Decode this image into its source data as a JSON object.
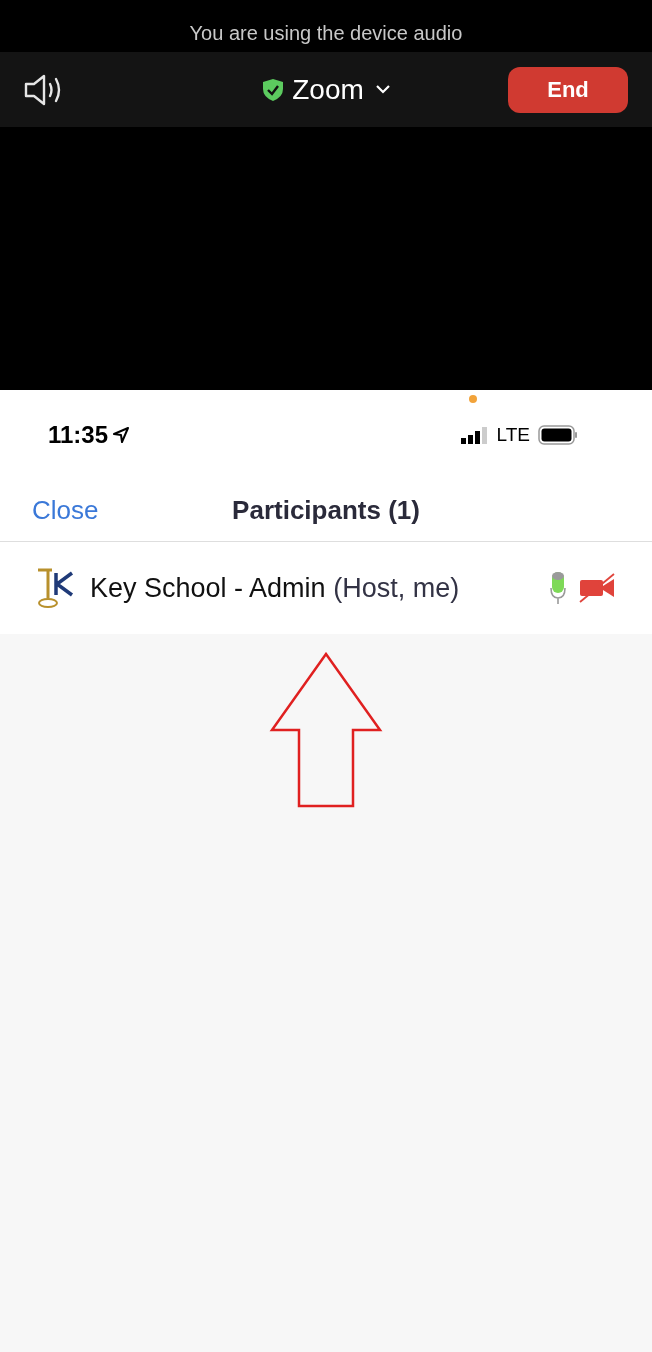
{
  "audio_notice": "You are using the device audio",
  "meeting_bar": {
    "title": "Zoom",
    "encrypted": true,
    "end_label": "End"
  },
  "status_bar": {
    "time": "11:35",
    "network": "LTE",
    "mic_in_use": true
  },
  "header": {
    "close_label": "Close",
    "title": "Participants (1)"
  },
  "participants": [
    {
      "name": "Key School - Admin",
      "role": "(Host, me)",
      "mic_on": true,
      "video_on": false
    }
  ],
  "annotation": {
    "kind": "up-arrow",
    "color": "#e02020"
  }
}
